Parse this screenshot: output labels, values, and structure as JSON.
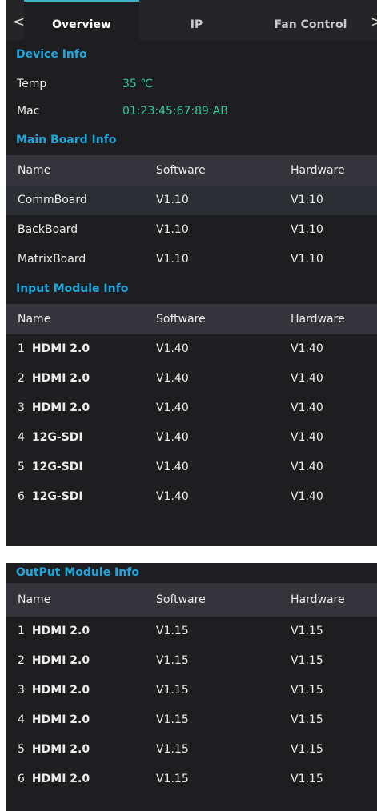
{
  "tabs": [
    {
      "label": "Overview",
      "active": true
    },
    {
      "label": "IP",
      "active": false
    },
    {
      "label": "Fan Control",
      "active": false
    }
  ],
  "nav": {
    "prev": "<",
    "next": ">"
  },
  "device_info": {
    "title": "Device Info",
    "rows": [
      {
        "label": "Temp",
        "value": "35 ℃"
      },
      {
        "label": "Mac",
        "value": "01:23:45:67:89:AB"
      }
    ]
  },
  "main_board": {
    "title": "Main Board Info",
    "headers": {
      "name": "Name",
      "software": "Software",
      "hardware": "Hardware"
    },
    "rows": [
      {
        "name": "CommBoard",
        "software": "V1.10",
        "hardware": "V1.10"
      },
      {
        "name": "BackBoard",
        "software": "V1.10",
        "hardware": "V1.10"
      },
      {
        "name": "MatrixBoard",
        "software": "V1.10",
        "hardware": "V1.10"
      }
    ]
  },
  "input_module": {
    "title": "Input Module Info",
    "headers": {
      "name": "Name",
      "software": "Software",
      "hardware": "Hardware"
    },
    "rows": [
      {
        "index": "1",
        "name": "HDMI 2.0",
        "software": "V1.40",
        "hardware": "V1.40"
      },
      {
        "index": "2",
        "name": "HDMI 2.0",
        "software": "V1.40",
        "hardware": "V1.40"
      },
      {
        "index": "3",
        "name": "HDMI 2.0",
        "software": "V1.40",
        "hardware": "V1.40"
      },
      {
        "index": "4",
        "name": "12G-SDI",
        "software": "V1.40",
        "hardware": "V1.40"
      },
      {
        "index": "5",
        "name": "12G-SDI",
        "software": "V1.40",
        "hardware": "V1.40"
      },
      {
        "index": "6",
        "name": "12G-SDI",
        "software": "V1.40",
        "hardware": "V1.40"
      }
    ]
  },
  "output_module": {
    "title": "OutPut Module Info",
    "headers": {
      "name": "Name",
      "software": "Software",
      "hardware": "Hardware"
    },
    "rows": [
      {
        "index": "1",
        "name": "HDMI 2.0",
        "software": "V1.15",
        "hardware": "V1.15"
      },
      {
        "index": "2",
        "name": "HDMI 2.0",
        "software": "V1.15",
        "hardware": "V1.15"
      },
      {
        "index": "3",
        "name": "HDMI 2.0",
        "software": "V1.15",
        "hardware": "V1.15"
      },
      {
        "index": "4",
        "name": "HDMI 2.0",
        "software": "V1.15",
        "hardware": "V1.15"
      },
      {
        "index": "5",
        "name": "HDMI 2.0",
        "software": "V1.15",
        "hardware": "V1.15"
      },
      {
        "index": "6",
        "name": "HDMI 2.0",
        "software": "V1.15",
        "hardware": "V1.15"
      }
    ]
  },
  "colors": {
    "panel_bg": "#1e1e21",
    "section_title": "#1fa7dc",
    "value_text": "#2fc7a2",
    "table_header_bg": "#34343a",
    "tab_accent": "#3bb1c4"
  }
}
